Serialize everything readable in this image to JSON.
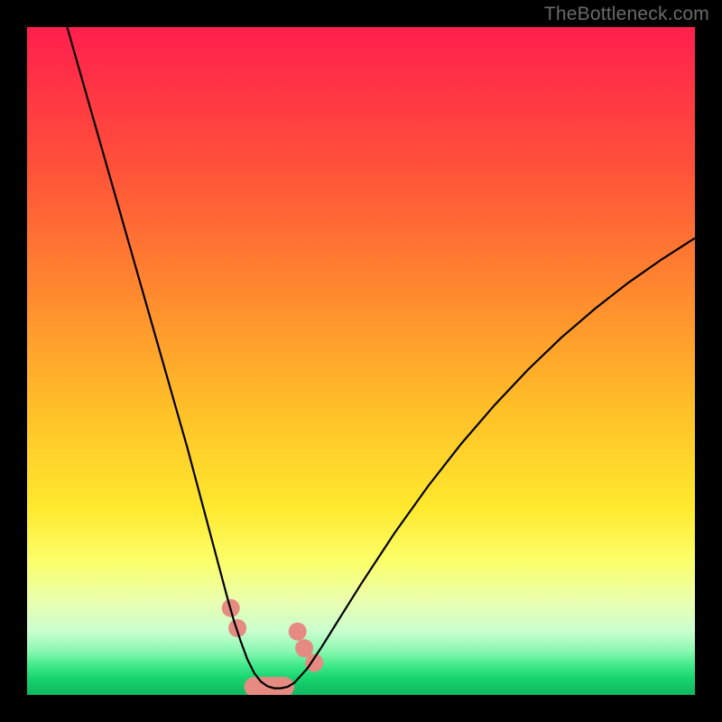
{
  "watermark": {
    "text": "TheBottleneck.com"
  },
  "chart_data": {
    "type": "line",
    "title": "",
    "xlabel": "",
    "ylabel": "",
    "xlim": [
      0,
      100
    ],
    "ylim": [
      0,
      100
    ],
    "grid": false,
    "legend": false,
    "annotations": [],
    "background_gradient_stops": [
      {
        "pos": 0.0,
        "color": "#ff1f4d"
      },
      {
        "pos": 0.2,
        "color": "#ff4f3a"
      },
      {
        "pos": 0.4,
        "color": "#ff8a2e"
      },
      {
        "pos": 0.58,
        "color": "#ffc228"
      },
      {
        "pos": 0.72,
        "color": "#ffe92e"
      },
      {
        "pos": 0.8,
        "color": "#fbff6a"
      },
      {
        "pos": 0.86,
        "color": "#eaffb0"
      },
      {
        "pos": 0.905,
        "color": "#c9ffcf"
      },
      {
        "pos": 0.935,
        "color": "#89f7b0"
      },
      {
        "pos": 0.958,
        "color": "#3ae886"
      },
      {
        "pos": 0.975,
        "color": "#19d46f"
      },
      {
        "pos": 1.0,
        "color": "#0fb85f"
      }
    ],
    "series": [
      {
        "name": "bottleneck-curve",
        "stroke": "#000000",
        "x": [
          6,
          8,
          10,
          12,
          14,
          16,
          18,
          20,
          22,
          24,
          26,
          28,
          30,
          31,
          32,
          33,
          34,
          35,
          36,
          37,
          38,
          39,
          40,
          42,
          44,
          46,
          50,
          55,
          60,
          65,
          70,
          75,
          80,
          85,
          90,
          95,
          100
        ],
        "y": [
          100,
          93,
          86,
          79,
          72,
          65,
          58,
          51,
          44,
          37,
          29.5,
          22,
          14.5,
          11,
          8,
          5.3,
          3.3,
          2.0,
          1.3,
          1.0,
          1.0,
          1.2,
          1.8,
          4.0,
          7.0,
          10.2,
          16.6,
          24.2,
          31.2,
          37.6,
          43.4,
          48.7,
          53.5,
          57.8,
          61.7,
          65.2,
          68.4
        ]
      }
    ],
    "markers": {
      "name": "highlight-dots",
      "color": "#e58b82",
      "radius_px": 10,
      "points": [
        {
          "x": 30.5,
          "y": 13
        },
        {
          "x": 31.5,
          "y": 10
        },
        {
          "x": 40.5,
          "y": 9.5
        },
        {
          "x": 41.5,
          "y": 7
        },
        {
          "x": 43.0,
          "y": 4.8
        }
      ]
    },
    "floor_band": {
      "name": "bottom-pill",
      "color": "#e58b82",
      "x_start": 32.5,
      "x_end": 40.0,
      "y": 1.2,
      "thickness_pct": 3.0
    }
  }
}
